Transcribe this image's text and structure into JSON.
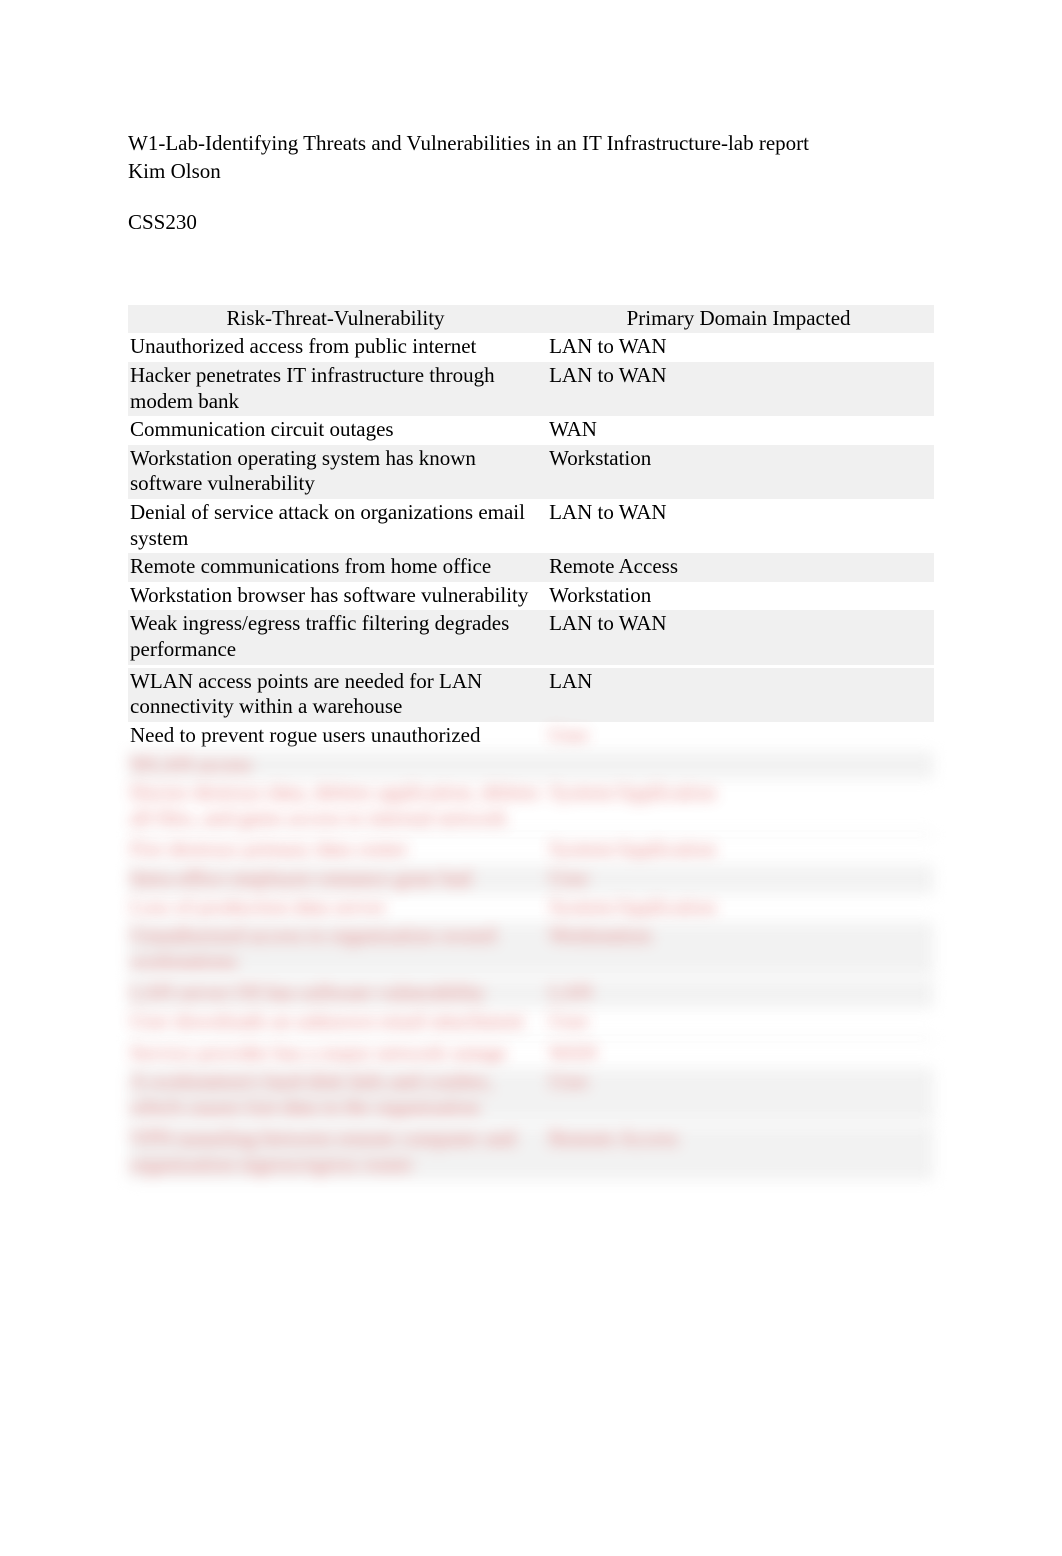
{
  "heading": {
    "line1": "W1-Lab-Identifying Threats and Vulnerabilities in an IT Infrastructure-lab report",
    "line2": "Kim Olson",
    "line3": "CSS230"
  },
  "table": {
    "headers": {
      "col1": "Risk-Threat-Vulnerability",
      "col2": "Primary Domain Impacted"
    },
    "rows": [
      {
        "c1": "Unauthorized access from public internet",
        "c2": "LAN to WAN",
        "alt": false
      },
      {
        "c1": "Hacker penetrates IT infrastructure through modem bank",
        "c2": "LAN to WAN",
        "alt": true
      },
      {
        "c1": "Communication circuit outages",
        "c2": "WAN",
        "alt": false
      },
      {
        "c1": "Workstation operating system has known software vulnerability",
        "c2": "Workstation",
        "alt": true
      },
      {
        "c1": "Denial of service attack on organizations email system",
        "c2": "LAN to WAN",
        "alt": false
      },
      {
        "c1": "Remote communications from home office",
        "c2": "Remote Access",
        "alt": true
      },
      {
        "c1": "Workstation browser has software vulnerability",
        "c2": "Workstation",
        "alt": false
      },
      {
        "c1": "Weak ingress/egress traffic filtering degrades performance",
        "c2": "LAN to WAN",
        "alt": true
      },
      {
        "c1": "",
        "c2": "",
        "alt": false
      },
      {
        "c1": "WLAN access points are needed for LAN connectivity within a warehouse",
        "c2": "LAN",
        "alt": true
      }
    ],
    "partial": {
      "c1": "Need to prevent rogue users unauthorized",
      "c2_hidden": "User",
      "alt": false
    },
    "hidden_rows": [
      {
        "c1": "WLAN access",
        "c2": "",
        "alt": true
      },
      {
        "c1": "Doctor destroys data, deletes application, deletes all files, and gains access to internal network",
        "c2": "System/Application",
        "alt": false
      },
      {
        "c1": "",
        "c2": "",
        "alt": true
      },
      {
        "c1": "Fire destroys primary data center",
        "c2": "System/Application",
        "alt": false
      },
      {
        "c1": "Intra-office employee romance gone bad",
        "c2": "User",
        "alt": true
      },
      {
        "c1": "Loss of production data server",
        "c2": "System/Application",
        "alt": false
      },
      {
        "c1": "Unauthorized access to organization owned workstations",
        "c2": "Workstation",
        "alt": true
      },
      {
        "c1": "",
        "c2": "",
        "alt": false
      },
      {
        "c1": "LAN server OS has software vulnerability",
        "c2": "LAN",
        "alt": true
      },
      {
        "c1": "User downloads an unknown email attachment",
        "c2": "User",
        "alt": false
      },
      {
        "c1": "",
        "c2": "",
        "alt": true
      },
      {
        "c1": "Service provider has a major network outage",
        "c2": "WAN",
        "alt": false
      },
      {
        "c1": "A workstation's hard disk fails and crashes, which causes lost data in the organization",
        "c2": "User",
        "alt": true
      },
      {
        "c1": "",
        "c2": "",
        "alt": false
      },
      {
        "c1": "VPN tunneling between remote computer and organization ingress/egress router",
        "c2": "Remote Access",
        "alt": true
      }
    ]
  }
}
